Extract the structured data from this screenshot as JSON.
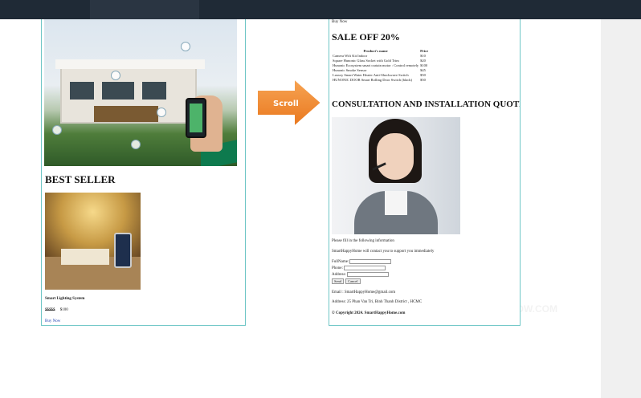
{
  "colors": {
    "topbar": "#1f2a36",
    "frame_border": "#6ec6c6",
    "arrow": "#f08a2c",
    "link": "#1a3fb0"
  },
  "watermark": {
    "left": "FUOVERFLOW.COM",
    "right": "FUOVERFLOW.COM"
  },
  "left_page": {
    "hero_icons": [
      "house-image",
      "smartphone-icon",
      "cctv-icon",
      "lightbulb-icon"
    ],
    "best_seller_heading": "BEST SELLER",
    "product_name": "Smart Lighting System",
    "price_label": "$$$$$",
    "price_value": "$100",
    "buy_link": "Buy Now"
  },
  "arrow": {
    "label": "Scroll"
  },
  "right_page": {
    "top_link": "Buy Now",
    "sale_heading": "SALE OFF 20%",
    "table": {
      "headers": [
        "Product's name",
        "Price"
      ],
      "rows": [
        [
          "Camera Wifi Kit Indoor",
          "$10"
        ],
        [
          "Square Hunonic Glass Socket with Gold Trim",
          "$20"
        ],
        [
          "Hunonic Ecosystem smart curtain motor : Control remotely",
          "$100"
        ],
        [
          "Hunonic Smoke Sensor",
          "$45"
        ],
        [
          "Luxury Smart Water Heater Anti-Shockwave Switch",
          "$50"
        ],
        [
          "HUNONIC DOOR Smart Rolling Door Switch (black)",
          "$50"
        ]
      ]
    },
    "consult_heading": "CONSULTATION AND INSTALLATION QUOTE",
    "form_intro": "Please fill in the following information",
    "form_note": "SmartHappyHome will contact you to support you immediately",
    "fullname_label": "FullName:",
    "phone_label": "Phone:",
    "address_label": "Address:",
    "send_label": "Send",
    "cancel_label": "Cancel",
    "email_text": "Email : SmartHappyHome@gmail.com",
    "address_text": "Address: 25 Phan Van Tri, Binh Thanh District , HCMC",
    "copyright": "© Copyright 2024. SmartHappyHome.com"
  }
}
